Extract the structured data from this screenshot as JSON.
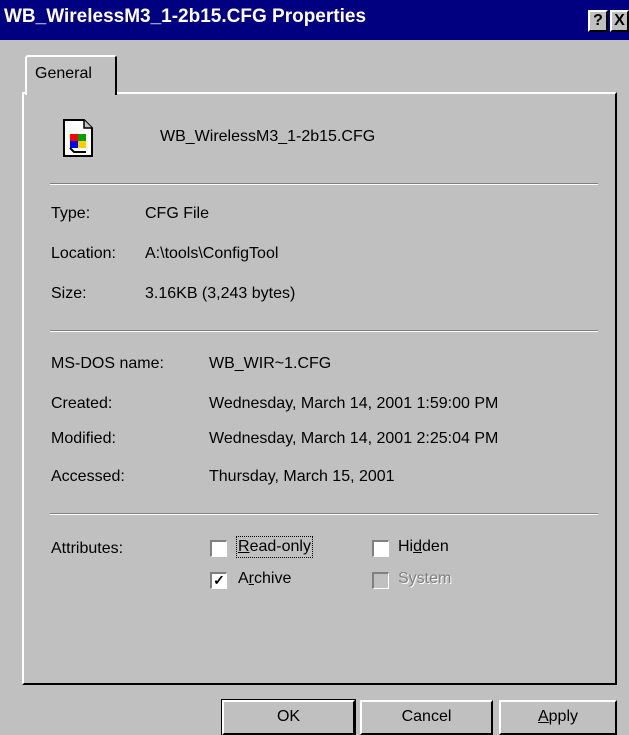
{
  "window": {
    "title": "WB_WirelessM3_1-2b15.CFG Properties"
  },
  "titlebar_buttons": {
    "help": "?",
    "close": "X"
  },
  "tabs": [
    {
      "label": "General"
    }
  ],
  "file": {
    "icon": "cfg-file-icon",
    "name": "WB_WirelessM3_1-2b15.CFG"
  },
  "info": {
    "type_label": "Type:",
    "type_value": "CFG File",
    "location_label": "Location:",
    "location_value": "A:\\tools\\ConfigTool",
    "size_label": "Size:",
    "size_value": "3.16KB (3,243 bytes)"
  },
  "dates": {
    "msdos_label": "MS-DOS name:",
    "msdos_value": "WB_WIR~1.CFG",
    "created_label": "Created:",
    "created_value": "Wednesday, March 14, 2001 1:59:00 PM",
    "modified_label": "Modified:",
    "modified_value": "Wednesday, March 14, 2001 2:25:04 PM",
    "accessed_label": "Accessed:",
    "accessed_value": "Thursday, March 15, 2001"
  },
  "attributes": {
    "label": "Attributes:",
    "readonly": {
      "pre": "",
      "key": "R",
      "post": "ead-only",
      "checked": false
    },
    "hidden": {
      "pre": "Hi",
      "key": "d",
      "post": "den",
      "checked": false
    },
    "archive": {
      "pre": "A",
      "key": "r",
      "post": "chive",
      "checked": true
    },
    "system": {
      "label": "System",
      "checked": false,
      "disabled": true
    }
  },
  "buttons": {
    "ok": "OK",
    "cancel": "Cancel",
    "apply_key": "A",
    "apply_rest": "pply"
  }
}
